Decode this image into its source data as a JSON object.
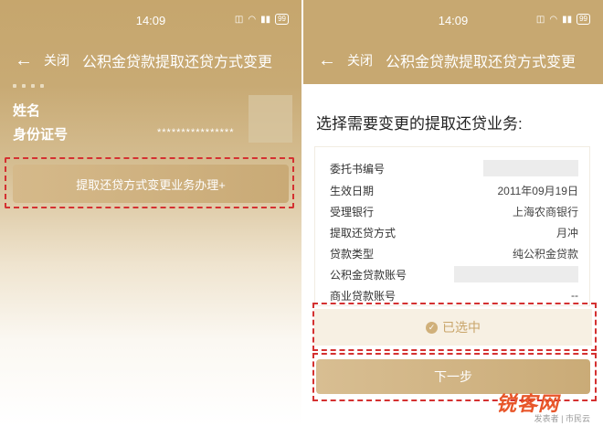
{
  "status": {
    "time": "14:09",
    "battery": "99"
  },
  "nav": {
    "close_label": "关闭",
    "title": "公积金贷款提取还贷方式变更"
  },
  "left": {
    "name_label": "姓名",
    "id_label": "身份证号",
    "id_value": "****************",
    "action_button": "提取还贷方式变更业务办理+"
  },
  "right": {
    "section_title": "选择需要变更的提取还贷业务:",
    "rows": [
      {
        "label": "委托书编号",
        "value": ""
      },
      {
        "label": "生效日期",
        "value": "2011年09月19日"
      },
      {
        "label": "受理银行",
        "value": "上海农商银行"
      },
      {
        "label": "提取还贷方式",
        "value": "月冲"
      },
      {
        "label": "贷款类型",
        "value": "纯公积金贷款"
      },
      {
        "label": "公积金贷款账号",
        "value": ""
      },
      {
        "label": "商业贷款账号",
        "value": "--"
      }
    ],
    "selected_label": "已选中",
    "next_button": "下一步"
  },
  "watermark": {
    "brand": "锐客网",
    "sub": "发表者 | 市民云"
  },
  "colors": {
    "gold": "#c7a871",
    "dashed_highlight": "#d43131",
    "selected_text": "#c9a56a"
  }
}
